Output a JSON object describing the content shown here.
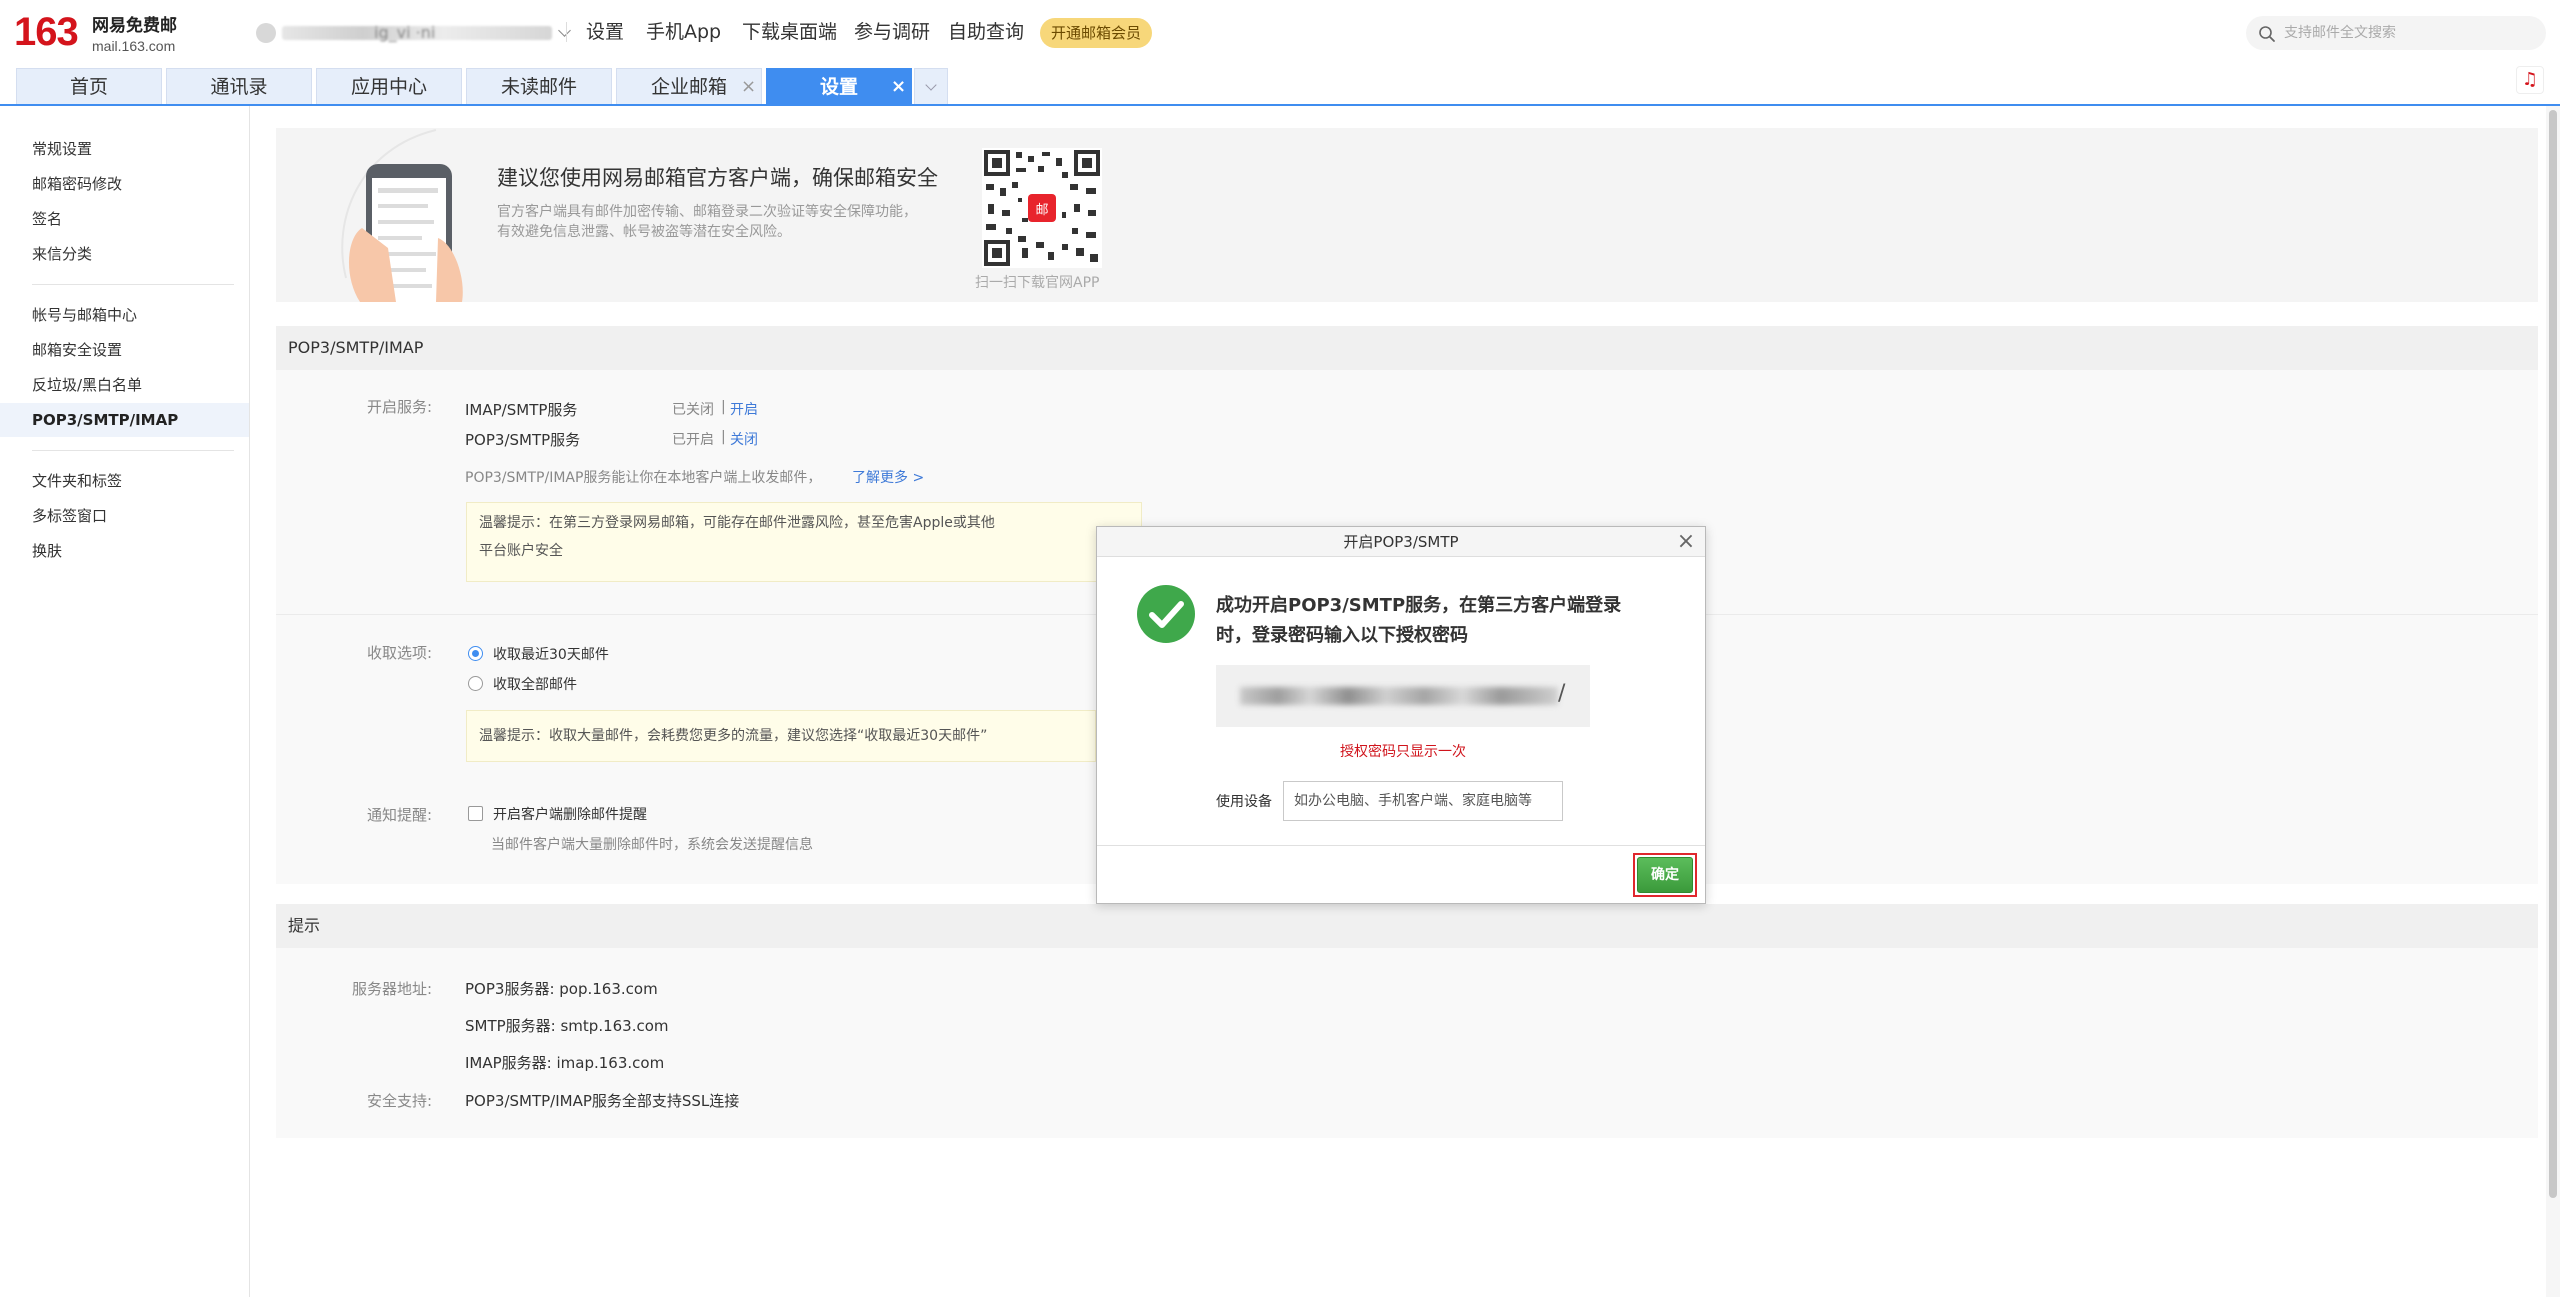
{
  "brand": {
    "logo_num": "163",
    "logo_cn": "网易免费邮",
    "logo_domain": "mail.163.com"
  },
  "account": {
    "name_fragment": "ig_vi  ·ni"
  },
  "topnav": [
    "设置",
    "手机App",
    "下载桌面端",
    "参与调研",
    "自助查询"
  ],
  "vip_button": "开通邮箱会员",
  "search": {
    "placeholder": "支持邮件全文搜索"
  },
  "tabs": [
    {
      "label": "首页"
    },
    {
      "label": "通讯录"
    },
    {
      "label": "应用中心"
    },
    {
      "label": "未读邮件"
    },
    {
      "label": "企业邮箱",
      "close": "×"
    },
    {
      "label": "设置",
      "close": "×",
      "active": true
    }
  ],
  "sidebar": {
    "group1": [
      "常规设置",
      "邮箱密码修改",
      "签名",
      "来信分类"
    ],
    "group2": [
      "帐号与邮箱中心",
      "邮箱安全设置",
      "反垃圾/黑白名单",
      "POP3/SMTP/IMAP"
    ],
    "group3": [
      "文件夹和标签",
      "多标签窗口",
      "换肤"
    ]
  },
  "banner": {
    "title": "建议您使用网易邮箱官方客户端，确保邮箱安全",
    "desc": "官方客户端具有邮件加密传输、邮箱登录二次验证等安全保障功能，有效避免信息泄露、帐号被盗等潜在安全风险。",
    "qr_caption": "扫一扫下载官网APP"
  },
  "pop3": {
    "section_title": "POP3/SMTP/IMAP",
    "service_label": "开启服务:",
    "imap_name": "IMAP/SMTP服务",
    "imap_status": "已关闭",
    "imap_action": "开启",
    "pop_name": "POP3/SMTP服务",
    "pop_status": "已开启",
    "pop_action": "关闭",
    "separator": "|",
    "info": "POP3/SMTP/IMAP服务能让你在本地客户端上收发邮件，",
    "learn_more": "了解更多 >",
    "warn_line1": "温馨提示：在第三方登录网易邮箱，可能存在邮件泄露风险，甚至危害Apple或其他",
    "warn_line2": "平台账户安全",
    "receive_label": "收取选项:",
    "receive_opt1": "收取最近30天邮件",
    "receive_opt2": "收取全部邮件",
    "receive_tip": "温馨提示：收取大量邮件，会耗费您更多的流量，建议您选择“收取最近30天邮件”",
    "notify_label": "通知提醒:",
    "notify_opt": "开启客户端删除邮件提醒",
    "notify_desc": "当邮件客户端大量删除邮件时，系统会发送提醒信息"
  },
  "tips": {
    "section_title": "提示",
    "server_label": "服务器地址:",
    "pop3": "POP3服务器: pop.163.com",
    "smtp": "SMTP服务器: smtp.163.com",
    "imap": "IMAP服务器: imap.163.com",
    "ssl_label": "安全支持:",
    "ssl": "POP3/SMTP/IMAP服务全部支持SSL连接"
  },
  "dialog": {
    "title": "开启POP3/SMTP",
    "close": "×",
    "message": "成功开启POP3/SMTP服务，在第三方客户端登录时，登录密码输入以下授权密码",
    "code_suffix": "/",
    "code_note": "授权密码只显示一次",
    "device_label": "使用设备",
    "device_placeholder": "如办公电脑、手机客户端、家庭电脑等",
    "ok": "确定"
  },
  "colors": {
    "brand_red": "#d4141c",
    "tab_active": "#3f8df0",
    "ok_green": "#3fa84b",
    "link": "#3f7ad8"
  },
  "icons": [
    "search-icon",
    "music-icon",
    "checkmark-icon",
    "close-icon",
    "qr-code-icon",
    "chevron-down-icon"
  ]
}
